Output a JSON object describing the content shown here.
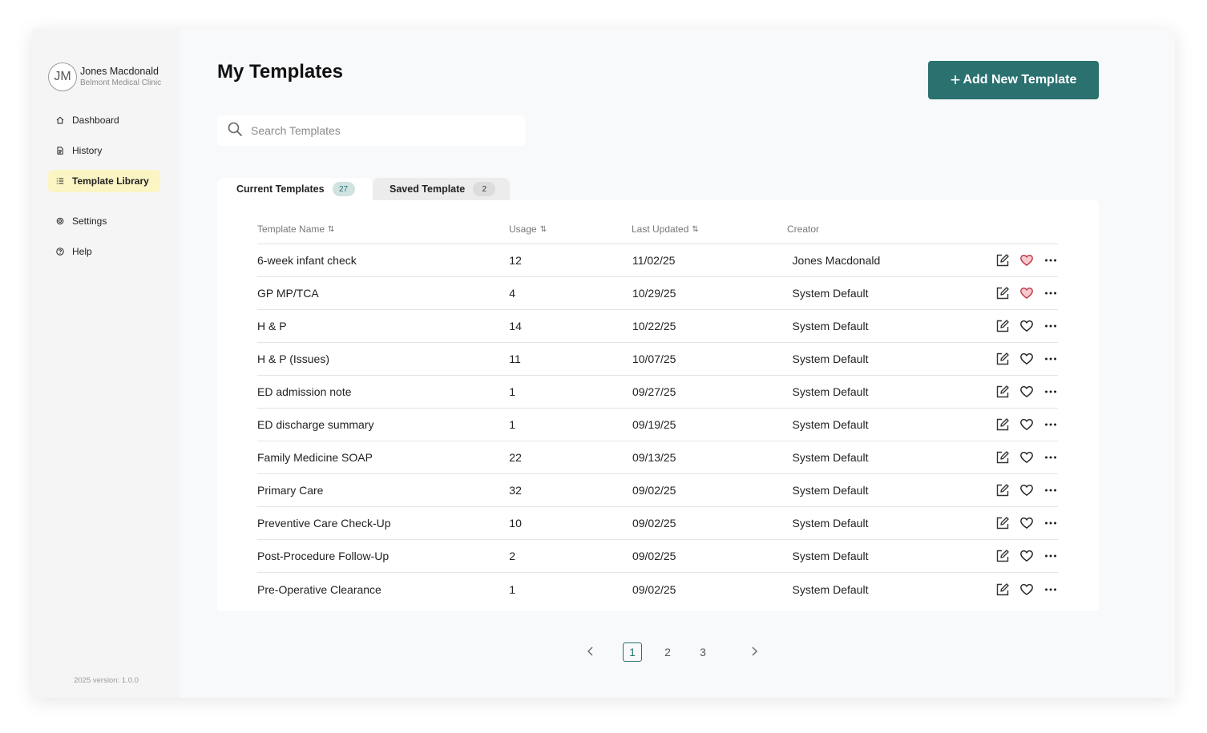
{
  "profile": {
    "initials": "JM",
    "name": "Jones Macdonald",
    "clinic": "Belmont Medical Clinic"
  },
  "sidebar": {
    "items": [
      {
        "label": "Dashboard",
        "icon": "home-icon"
      },
      {
        "label": "History",
        "icon": "document-icon"
      },
      {
        "label": "Template Library",
        "icon": "list-icon",
        "active": true
      },
      {
        "label": "Settings",
        "icon": "gear-icon"
      },
      {
        "label": "Help",
        "icon": "help-icon"
      }
    ],
    "version": "2025 version: 1.0.0"
  },
  "header": {
    "title": "My Templates",
    "add_button_label": "Add New Template"
  },
  "search": {
    "placeholder": "Search Templates",
    "value": ""
  },
  "tabs": [
    {
      "label": "Current Templates",
      "count": "27",
      "active": true
    },
    {
      "label": "Saved Template",
      "count": "2",
      "active": false
    }
  ],
  "table": {
    "columns": [
      "Template Name",
      "Usage",
      "Last Updated",
      "Creator"
    ],
    "rows": [
      {
        "name": "6-week infant check",
        "usage": "12",
        "updated": "11/02/25",
        "creator": "Jones Macdonald",
        "favorite": true
      },
      {
        "name": "GP MP/TCA",
        "usage": "4",
        "updated": "10/29/25",
        "creator": "System Default",
        "favorite": true
      },
      {
        "name": "H & P",
        "usage": "14",
        "updated": "10/22/25",
        "creator": "System Default",
        "favorite": false
      },
      {
        "name": "H & P (Issues)",
        "usage": "11",
        "updated": "10/07/25",
        "creator": "System Default",
        "favorite": false
      },
      {
        "name": "ED admission note",
        "usage": "1",
        "updated": "09/27/25",
        "creator": "System Default",
        "favorite": false
      },
      {
        "name": "ED discharge summary",
        "usage": "1",
        "updated": "09/19/25",
        "creator": "System Default",
        "favorite": false
      },
      {
        "name": "Family Medicine SOAP",
        "usage": "22",
        "updated": "09/13/25",
        "creator": "System Default",
        "favorite": false
      },
      {
        "name": "Primary Care",
        "usage": "32",
        "updated": "09/02/25",
        "creator": "System Default",
        "favorite": false
      },
      {
        "name": "Preventive Care Check-Up",
        "usage": "10",
        "updated": "09/02/25",
        "creator": "System Default",
        "favorite": false
      },
      {
        "name": "Post-Procedure Follow-Up",
        "usage": "2",
        "updated": "09/02/25",
        "creator": "System Default",
        "favorite": false
      },
      {
        "name": "Pre-Operative Clearance",
        "usage": "1",
        "updated": "09/02/25",
        "creator": "System Default",
        "favorite": false
      }
    ]
  },
  "pagination": {
    "pages": [
      "1",
      "2",
      "3"
    ],
    "current": "1"
  },
  "colors": {
    "accent": "#2a7170",
    "active_nav_bg": "#fbf5c4",
    "favorite_fill": "#f6c9cc",
    "favorite_stroke": "#c0394b"
  }
}
